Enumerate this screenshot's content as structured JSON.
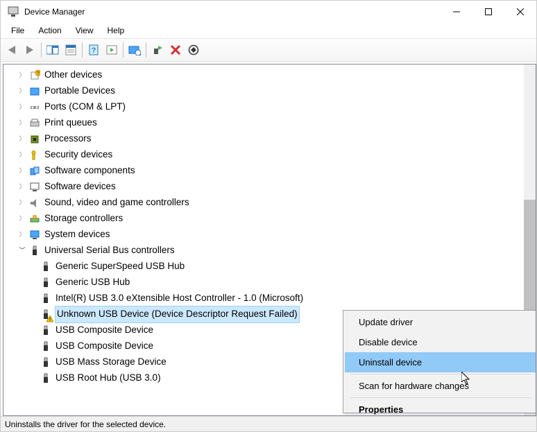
{
  "window": {
    "title": "Device Manager"
  },
  "menu": {
    "file": "File",
    "action": "Action",
    "view": "View",
    "help": "Help"
  },
  "tree": {
    "top": [
      "Other devices",
      "Portable Devices",
      "Ports (COM & LPT)",
      "Print queues",
      "Processors",
      "Security devices",
      "Software components",
      "Software devices",
      "Sound, video and game controllers",
      "Storage controllers",
      "System devices"
    ],
    "usb_category": "Universal Serial Bus controllers",
    "usb_children": [
      "Generic SuperSpeed USB Hub",
      "Generic USB Hub",
      "Intel(R) USB 3.0 eXtensible Host Controller - 1.0 (Microsoft)"
    ],
    "usb_selected": "Unknown USB Device (Device Descriptor Request Failed)",
    "usb_after": [
      "USB Composite Device",
      "USB Composite Device",
      "USB Mass Storage Device",
      "USB Root Hub (USB 3.0)"
    ]
  },
  "context_menu": {
    "update": "Update driver",
    "disable": "Disable device",
    "uninstall": "Uninstall device",
    "scan": "Scan for hardware changes",
    "properties": "Properties"
  },
  "status": "Uninstalls the driver for the selected device."
}
